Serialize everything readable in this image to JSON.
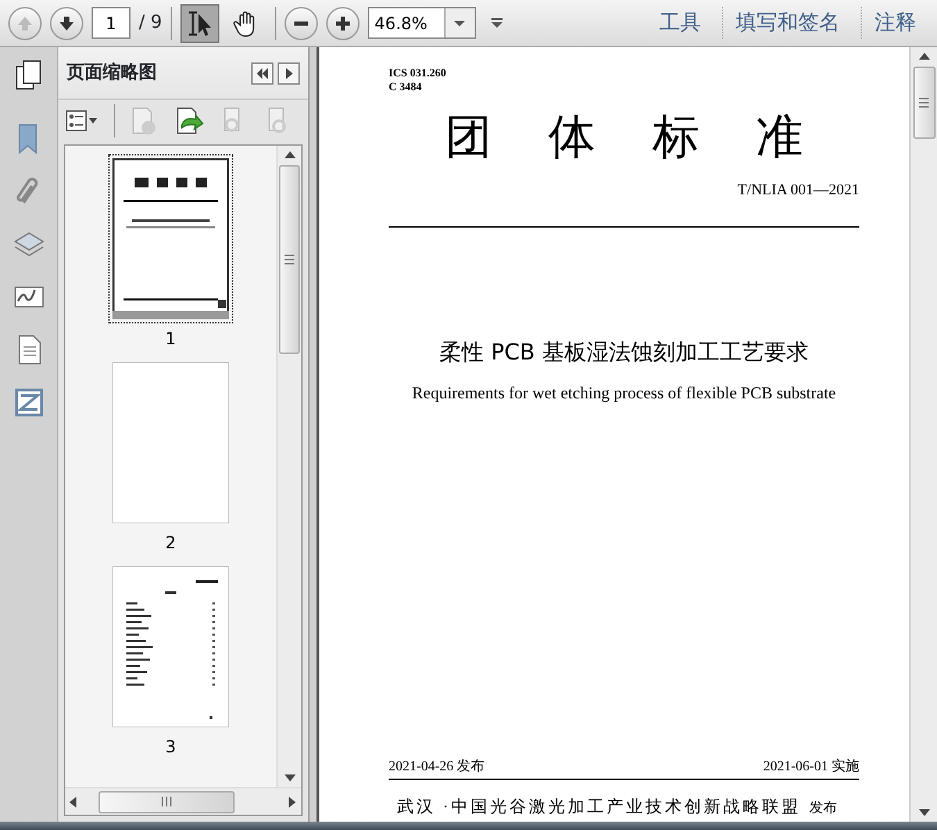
{
  "toolbar": {
    "page_input": "1",
    "page_total": "/ 9",
    "tools": [
      {
        "kind": "select",
        "selected": true
      },
      {
        "kind": "hand",
        "selected": false
      }
    ],
    "zoom": "46.8%",
    "menu": [
      "工具",
      "填写和签名",
      "注释"
    ]
  },
  "side_panel": {
    "title": "页面缩略图",
    "thumbnails": [
      {
        "kind": "cover",
        "label": "1",
        "selected": true
      },
      {
        "kind": "blank",
        "label": "2",
        "selected": false
      },
      {
        "kind": "contents",
        "label": "3",
        "selected": false
      }
    ]
  },
  "document": {
    "ics": "ICS  031.260",
    "ccs": "C 3484",
    "heading": "团 体 标 准",
    "code": "T/NLIA 001—2021",
    "title_cn": "柔性 PCB 基板湿法蚀刻加工工艺要求",
    "title_en": "Requirements for wet etching process of flexible PCB substrate",
    "publish_date": "2021-04-26 发布",
    "effective_date": "2021-06-01 实施",
    "publisher": "武汉 ·中国光谷激光加工产业技术创新战略联盟",
    "publisher_suffix": "发布"
  }
}
